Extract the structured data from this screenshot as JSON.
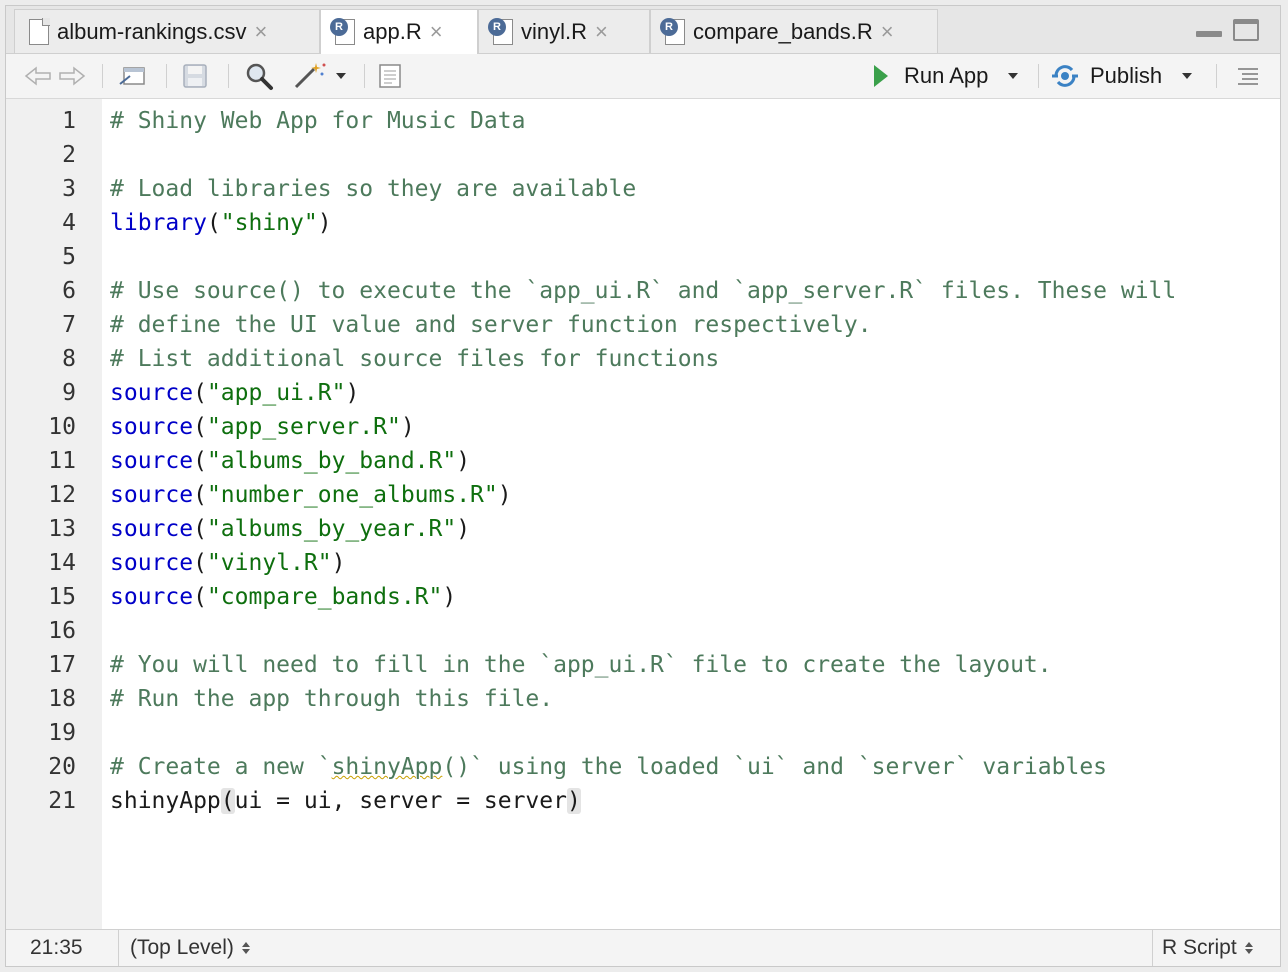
{
  "tabs": [
    {
      "label": "album-rankings.csv",
      "icon": "csv-file-icon",
      "active": false
    },
    {
      "label": "app.R",
      "icon": "r-file-icon",
      "active": true
    },
    {
      "label": "vinyl.R",
      "icon": "r-file-icon",
      "active": false
    },
    {
      "label": "compare_bands.R",
      "icon": "r-file-icon",
      "active": false
    }
  ],
  "tab_close_glyph": "×",
  "r_badge": "R",
  "toolbar": {
    "run_label": "Run App",
    "publish_label": "Publish"
  },
  "editor": {
    "lines": [
      {
        "n": "1",
        "parts": [
          {
            "t": "# Shiny Web App for Music Data",
            "c": "comment"
          }
        ]
      },
      {
        "n": "2",
        "parts": []
      },
      {
        "n": "3",
        "parts": [
          {
            "t": "# Load libraries so they are available",
            "c": "comment"
          }
        ]
      },
      {
        "n": "4",
        "parts": [
          {
            "t": "library",
            "c": "kw"
          },
          {
            "t": "(",
            "c": "plain"
          },
          {
            "t": "\"shiny\"",
            "c": "str"
          },
          {
            "t": ")",
            "c": "plain"
          }
        ]
      },
      {
        "n": "5",
        "parts": []
      },
      {
        "n": "6",
        "parts": [
          {
            "t": "# Use source() to execute the `app_ui.R` and `app_server.R` files. These will",
            "c": "comment"
          }
        ]
      },
      {
        "n": "7",
        "parts": [
          {
            "t": "# define the UI value and server function respectively.",
            "c": "comment"
          }
        ]
      },
      {
        "n": "8",
        "parts": [
          {
            "t": "# List additional source files for functions",
            "c": "comment"
          }
        ]
      },
      {
        "n": "9",
        "parts": [
          {
            "t": "source",
            "c": "kw"
          },
          {
            "t": "(",
            "c": "plain"
          },
          {
            "t": "\"app_ui.R\"",
            "c": "str"
          },
          {
            "t": ")",
            "c": "plain"
          }
        ]
      },
      {
        "n": "10",
        "parts": [
          {
            "t": "source",
            "c": "kw"
          },
          {
            "t": "(",
            "c": "plain"
          },
          {
            "t": "\"app_server.R\"",
            "c": "str"
          },
          {
            "t": ")",
            "c": "plain"
          }
        ]
      },
      {
        "n": "11",
        "parts": [
          {
            "t": "source",
            "c": "kw"
          },
          {
            "t": "(",
            "c": "plain"
          },
          {
            "t": "\"albums_by_band.R\"",
            "c": "str"
          },
          {
            "t": ")",
            "c": "plain"
          }
        ]
      },
      {
        "n": "12",
        "parts": [
          {
            "t": "source",
            "c": "kw"
          },
          {
            "t": "(",
            "c": "plain"
          },
          {
            "t": "\"number_one_albums.R\"",
            "c": "str"
          },
          {
            "t": ")",
            "c": "plain"
          }
        ]
      },
      {
        "n": "13",
        "parts": [
          {
            "t": "source",
            "c": "kw"
          },
          {
            "t": "(",
            "c": "plain"
          },
          {
            "t": "\"albums_by_year.R\"",
            "c": "str"
          },
          {
            "t": ")",
            "c": "plain"
          }
        ]
      },
      {
        "n": "14",
        "parts": [
          {
            "t": "source",
            "c": "kw"
          },
          {
            "t": "(",
            "c": "plain"
          },
          {
            "t": "\"vinyl.R\"",
            "c": "str"
          },
          {
            "t": ")",
            "c": "plain"
          }
        ]
      },
      {
        "n": "15",
        "parts": [
          {
            "t": "source",
            "c": "kw"
          },
          {
            "t": "(",
            "c": "plain"
          },
          {
            "t": "\"compare_bands.R\"",
            "c": "str"
          },
          {
            "t": ")",
            "c": "plain"
          }
        ]
      },
      {
        "n": "16",
        "parts": []
      },
      {
        "n": "17",
        "parts": [
          {
            "t": "# You will need to fill in the `app_ui.R` file to create the layout.",
            "c": "comment"
          }
        ]
      },
      {
        "n": "18",
        "parts": [
          {
            "t": "# Run the app through this file.",
            "c": "comment"
          }
        ]
      },
      {
        "n": "19",
        "parts": []
      },
      {
        "n": "20",
        "parts": [
          {
            "t": "# Create a new `",
            "c": "comment"
          },
          {
            "t": "shinyApp",
            "c": "comment squig"
          },
          {
            "t": "()` using the loaded `ui` and `server` variables",
            "c": "comment"
          }
        ]
      },
      {
        "n": "21",
        "parts": [
          {
            "t": "shinyApp",
            "c": "plain"
          },
          {
            "t": "(",
            "c": "plain hl"
          },
          {
            "t": "ui = ui, server = server",
            "c": "plain"
          },
          {
            "t": ")",
            "c": "plain hl"
          }
        ]
      }
    ]
  },
  "status": {
    "cursor": "21:35",
    "scope": "(Top Level)",
    "file_type": "R Script"
  }
}
